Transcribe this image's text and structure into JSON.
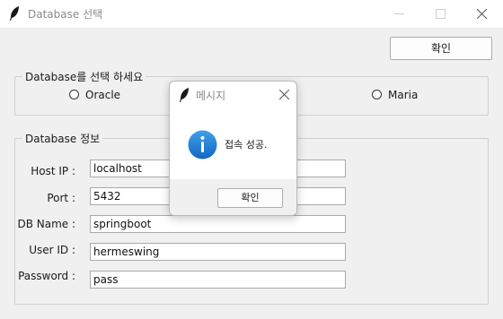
{
  "window": {
    "title": "Database 선택",
    "app_icon": "feather-icon",
    "controls": [
      "minimize-icon",
      "maximize-icon",
      "close-icon"
    ]
  },
  "top_button": {
    "label": "확인"
  },
  "db_select": {
    "legend": "Database를 선택 하세요",
    "options": [
      {
        "label": "Oracle",
        "selected": false
      },
      {
        "label": "Maria",
        "selected": false
      }
    ]
  },
  "db_info": {
    "legend": "Database 정보",
    "fields": {
      "host": {
        "label": "Host IP :",
        "value": "localhost"
      },
      "port": {
        "label": "Port :",
        "value": "5432"
      },
      "db_name": {
        "label": "DB Name :",
        "value": "springboot"
      },
      "user_id": {
        "label": "User ID :",
        "value": "hermeswing"
      },
      "password": {
        "label": "Password :",
        "value": "pass"
      }
    }
  },
  "message_box": {
    "title": "메시지",
    "icon": "info-icon",
    "message": "접속 성공.",
    "ok_label": "확인",
    "accent_color": "#1e7fd6"
  }
}
